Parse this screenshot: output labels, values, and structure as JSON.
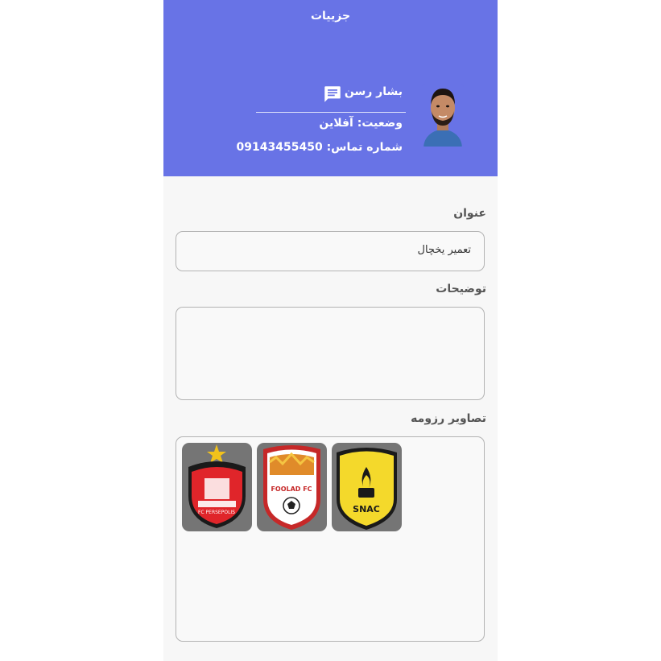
{
  "header": {
    "title": "جزییات",
    "background_color": "#6873e6",
    "name": "بشار رسن",
    "status": "وضعیت: آفلاین",
    "phone_label": "شماره تماس:",
    "phone_number": "09143455450",
    "chat_icon": "message-icon"
  },
  "form": {
    "title_label": "عنوان",
    "title_value": "تعمیر یخچال",
    "description_label": "توضیحات",
    "description_value": "",
    "resume_images_label": "تصاویر رزومه",
    "resume_images": [
      {
        "name": "snac-logo",
        "text": "SNAC"
      },
      {
        "name": "foolad-fc-logo",
        "text": "FOOLAD FC"
      },
      {
        "name": "fc-persepolis-logo",
        "text": "FC PERSEPOLIS"
      }
    ]
  }
}
